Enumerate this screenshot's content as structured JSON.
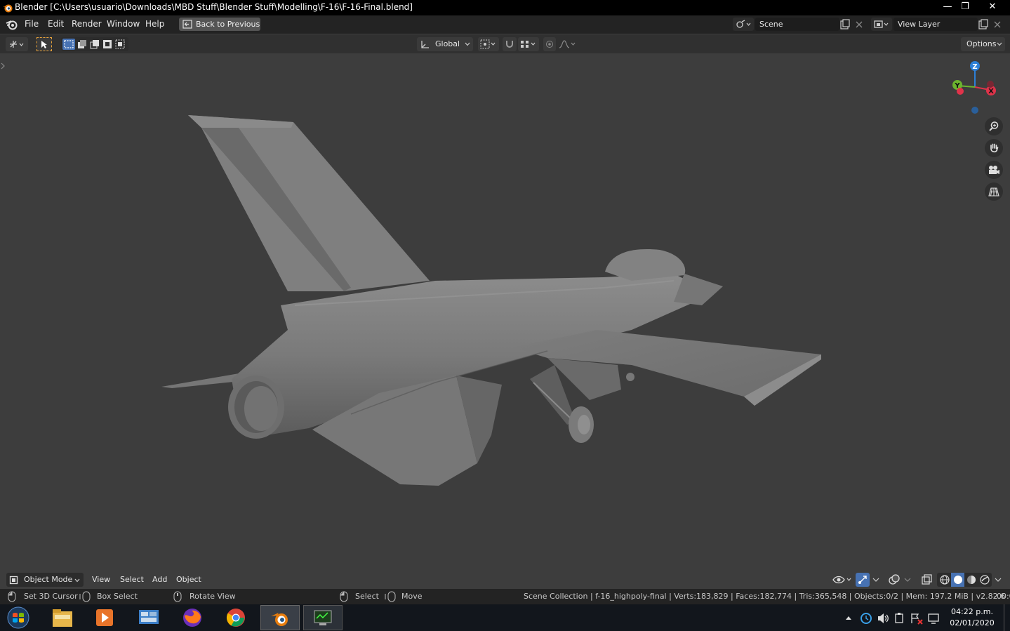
{
  "window": {
    "title": "Blender [C:\\Users\\usuario\\Downloads\\MBD Stuff\\Blender Stuff\\Modelling\\F-16\\F-16-Final.blend]",
    "minimize_glyph": "—",
    "maximize_glyph": "❐",
    "close_glyph": "✕"
  },
  "topbar": {
    "menus": [
      "File",
      "Edit",
      "Render",
      "Window",
      "Help"
    ],
    "back_button": "Back to Previous",
    "scene": "Scene",
    "view_layer": "View Layer"
  },
  "header": {
    "orientation": "Global",
    "options": "Options"
  },
  "gizmo": {
    "z": "Z",
    "y": "Y",
    "x": "X"
  },
  "viewport_footer": {
    "mode": "Object Mode",
    "menus": [
      "View",
      "Select",
      "Add",
      "Object"
    ]
  },
  "statusbar": {
    "set_cursor": "Set 3D Cursor",
    "box_select": "Box Select",
    "rotate_view": "Rotate View",
    "select": "Select",
    "move": "Move",
    "stats": "Scene Collection | f-16_highpoly-final | Verts:183,829 | Faces:182,774 | Tris:365,548 | Objects:0/2 | Mem: 197.2 MiB | v2.82.6",
    "cut_off": "-00:0"
  },
  "taskbar": {
    "time": "04:22 p.m.",
    "date": "02/01/2020"
  },
  "colors": {
    "accent_selection": "#e8a23a",
    "gizmo_z": "#2d7fd6",
    "gizmo_y": "#6cb52e",
    "gizmo_x": "#e0334a",
    "active_button": "#4772b3"
  }
}
